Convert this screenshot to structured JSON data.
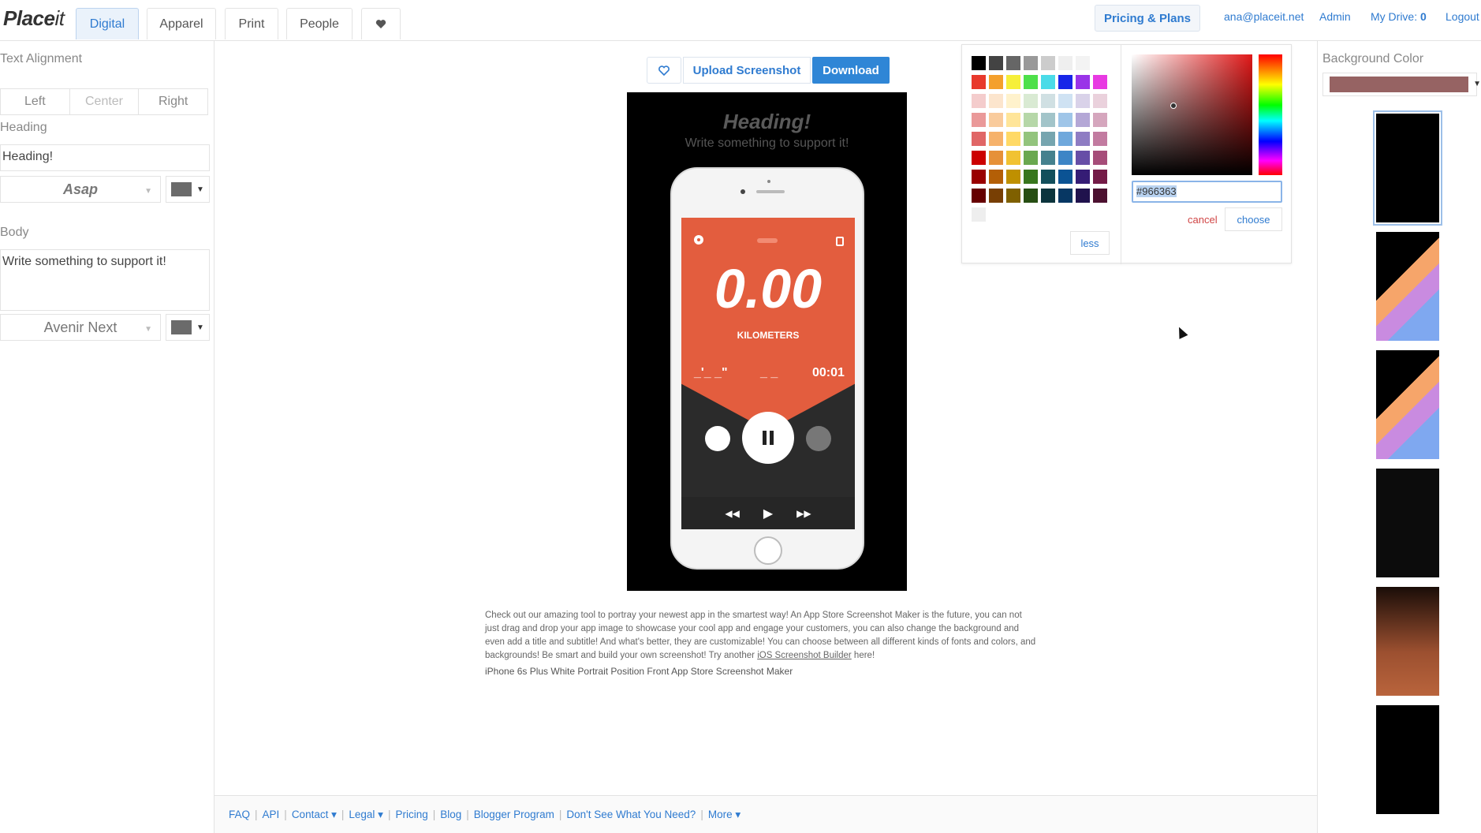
{
  "brand": {
    "logo_main": "Place",
    "logo_it": "it"
  },
  "nav": {
    "tabs": [
      {
        "label": "Digital",
        "active": true
      },
      {
        "label": "Apparel"
      },
      {
        "label": "Print"
      },
      {
        "label": "People"
      }
    ],
    "favorites_icon": "heart-icon",
    "pricing_label": "Pricing & Plans",
    "user_email": "ana@placeit.net",
    "admin_label": "Admin",
    "drive_label": "My Drive:",
    "drive_count": "0",
    "logout_label": "Logout"
  },
  "left_panel": {
    "text_alignment_label": "Text Alignment",
    "alignment_options": [
      "Left",
      "Center",
      "Right"
    ],
    "heading_label": "Heading",
    "heading_value": "Heading!",
    "heading_font": "Asap",
    "body_label": "Body",
    "body_value": "Write something to support it!",
    "body_font": "Avenir Next",
    "text_color": "#6b6b6b"
  },
  "toolbar": {
    "upload_label": "Upload Screenshot",
    "download_label": "Download"
  },
  "canvas": {
    "heading": "Heading!",
    "body": "Write something to support it!",
    "app_screen": {
      "distance": "0.00",
      "unit": "KILOMETERS",
      "pace": "_'_ _\"",
      "heart_rate": "_ _",
      "time": "00:01"
    }
  },
  "description": {
    "text": "Check out our amazing tool to portray your newest app in the smartest way! An App Store Screenshot Maker is the future, you can not just drag and drop your app image to showcase your cool app and engage your customers, you can also change the background and even add a title and subtitle! And what's better, they are customizable! You can choose between all different kinds of fonts and colors, and backgrounds! Be smart and build your own screenshot! Try another ",
    "link": "iOS Screenshot Builder",
    "suffix": " here!",
    "subtitle": "iPhone 6s Plus White Portrait Position Front App Store Screenshot Maker"
  },
  "color_picker": {
    "hex_value": "#966363",
    "less_label": "less",
    "cancel_label": "cancel",
    "choose_label": "choose",
    "swatch_rows": [
      [
        "#000000",
        "#434343",
        "#666666",
        "#999999",
        "#cccccc",
        "#efefef",
        "#f3f3f3",
        "#ffffff"
      ],
      [
        "#e8392c",
        "#f4a02c",
        "#f6ef3a",
        "#4ee04a",
        "#4adbe8",
        "#1826e8",
        "#9a34e8",
        "#e83ae2"
      ],
      [
        "#f4cccc",
        "#fce5cd",
        "#fff2cc",
        "#d9ead3",
        "#d0e0e3",
        "#cfe2f3",
        "#d9d2e9",
        "#ead1dc"
      ],
      [
        "#ea9999",
        "#f9cb9c",
        "#ffe599",
        "#b6d7a8",
        "#a2c4c9",
        "#9fc5e8",
        "#b4a7d6",
        "#d5a6bd"
      ],
      [
        "#e06666",
        "#f6b26b",
        "#ffd966",
        "#93c47d",
        "#76a5af",
        "#6fa8dc",
        "#8e7cc3",
        "#c27ba0"
      ],
      [
        "#cc0000",
        "#e69138",
        "#f1c232",
        "#6aa84f",
        "#45818e",
        "#3d85c6",
        "#674ea7",
        "#a64d79"
      ],
      [
        "#990000",
        "#b45f06",
        "#bf9000",
        "#38761d",
        "#134f5c",
        "#0b5394",
        "#351c75",
        "#741b47"
      ],
      [
        "#660000",
        "#783f04",
        "#7f6000",
        "#274e13",
        "#0c343d",
        "#073763",
        "#20124d",
        "#4c1130"
      ],
      [
        "#eeeeee"
      ]
    ]
  },
  "right_panel": {
    "bg_label": "Background Color",
    "bg_color": "#966363"
  },
  "footer": {
    "links": [
      "FAQ",
      "API",
      "Contact ▾",
      "Legal ▾",
      "Pricing",
      "Blog",
      "Blogger Program",
      "Don't See What You Need?",
      "More ▾"
    ]
  }
}
